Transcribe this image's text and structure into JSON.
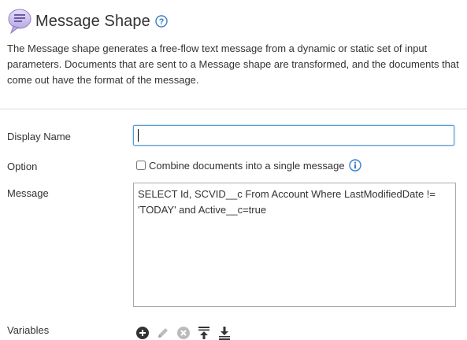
{
  "header": {
    "title": "Message Shape",
    "icon": "message-shape-icon",
    "help_icon": "help-icon"
  },
  "description": "The Message shape generates a free-flow text message from a dynamic or static set of input parameters. Documents that are sent to a Message shape are transformed, and the documents that come out have the format of the message.",
  "form": {
    "display_name": {
      "label": "Display Name",
      "value": ""
    },
    "option": {
      "label": "Option",
      "checkbox_label": "Combine documents into a single message",
      "checked": false,
      "info_icon": "info-icon"
    },
    "message": {
      "label": "Message",
      "value": "SELECT Id, SCVID__c From Account Where LastModifiedDate != 'TODAY' and Active__c=true"
    },
    "variables": {
      "label": "Variables",
      "tools": [
        "add-icon",
        "edit-icon",
        "remove-icon",
        "move-up-icon",
        "move-down-icon"
      ]
    }
  },
  "colors": {
    "accent": "#5b9bd5",
    "icon_dark": "#333333",
    "icon_disabled": "#bbbbbb",
    "help_blue": "#3a7dc9"
  }
}
